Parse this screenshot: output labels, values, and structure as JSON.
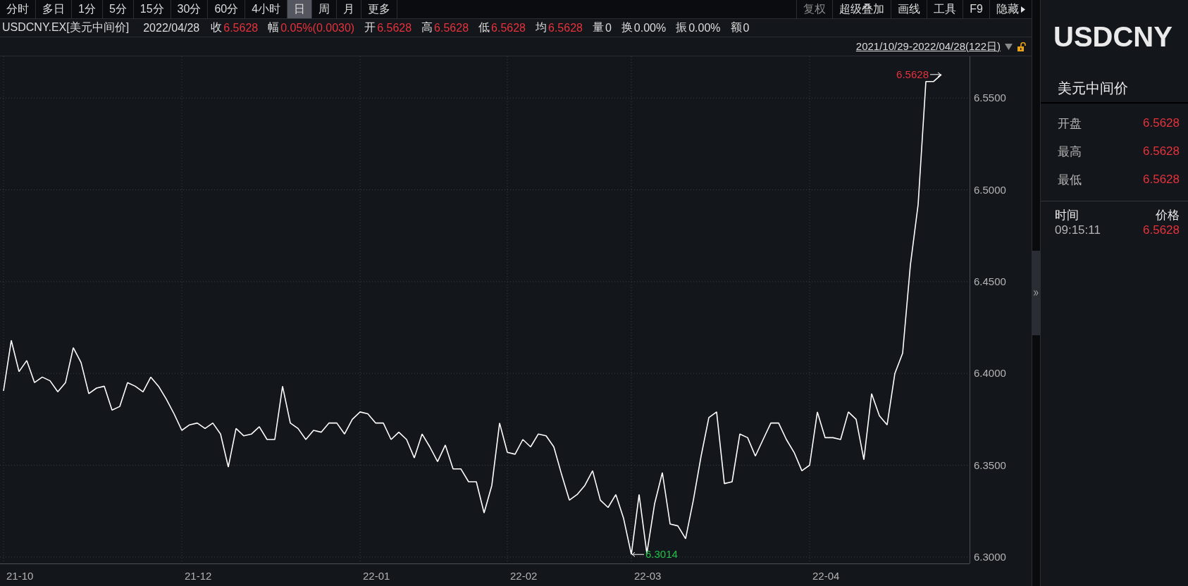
{
  "toolbar": {
    "periods": [
      {
        "label": "分时",
        "selected": false
      },
      {
        "label": "多日",
        "selected": false
      },
      {
        "label": "1分",
        "selected": false
      },
      {
        "label": "5分",
        "selected": false
      },
      {
        "label": "15分",
        "selected": false
      },
      {
        "label": "30分",
        "selected": false
      },
      {
        "label": "60分",
        "selected": false
      },
      {
        "label": "4小时",
        "selected": false
      },
      {
        "label": "日",
        "selected": true
      },
      {
        "label": "周",
        "selected": false
      },
      {
        "label": "月",
        "selected": false
      },
      {
        "label": "更多",
        "selected": false
      }
    ],
    "tools": [
      {
        "label": "复权",
        "disabled": true
      },
      {
        "label": "超级叠加",
        "disabled": false
      },
      {
        "label": "画线",
        "disabled": false
      },
      {
        "label": "工具",
        "disabled": false
      },
      {
        "label": "F9",
        "disabled": false
      },
      {
        "label": "隐藏",
        "disabled": false
      }
    ]
  },
  "quote": {
    "symbol": "USDCNY.EX[美元中间价]",
    "date": "2022/04/28",
    "fields": [
      {
        "label": "收",
        "value": "6.5628",
        "color": "#e8323c"
      },
      {
        "label": "幅",
        "value": "0.05%(0.0030)",
        "color": "#e8323c"
      },
      {
        "label": "开",
        "value": "6.5628",
        "color": "#e8323c"
      },
      {
        "label": "高",
        "value": "6.5628",
        "color": "#e8323c"
      },
      {
        "label": "低",
        "value": "6.5628",
        "color": "#e8323c"
      },
      {
        "label": "均",
        "value": "6.5628",
        "color": "#e8323c"
      },
      {
        "label": "量",
        "value": "0",
        "color": "#dcdcdc"
      },
      {
        "label": "换",
        "value": "0.00%",
        "color": "#dcdcdc"
      },
      {
        "label": "振",
        "value": "0.00%",
        "color": "#dcdcdc"
      },
      {
        "label": "额",
        "value": "0",
        "color": "#dcdcdc"
      }
    ]
  },
  "range": {
    "label": "2021/10/29-2022/04/28(122日)",
    "locked": false
  },
  "chart": {
    "chart_data": {
      "type": "line",
      "grid": true,
      "ylim": [
        6.2965,
        6.5727
      ],
      "yticks": [
        {
          "value": 6.3,
          "label": "6.3000"
        },
        {
          "value": 6.35,
          "label": "6.3500"
        },
        {
          "value": 6.4,
          "label": "6.4000"
        },
        {
          "value": 6.45,
          "label": "6.4500"
        },
        {
          "value": 6.5,
          "label": "6.5000"
        },
        {
          "value": 6.55,
          "label": "6.5500"
        }
      ],
      "series": [
        {
          "color": "#ffffff",
          "values": [
            6.3905,
            6.418,
            6.401,
            6.407,
            6.395,
            6.398,
            6.396,
            6.39,
            6.395,
            6.414,
            6.406,
            6.389,
            6.392,
            6.393,
            6.38,
            6.382,
            6.395,
            6.393,
            6.39,
            6.398,
            6.393,
            6.386,
            6.378,
            6.369,
            6.372,
            6.373,
            6.37,
            6.373,
            6.367,
            6.349,
            6.37,
            6.366,
            6.367,
            6.371,
            6.364,
            6.364,
            6.393,
            6.373,
            6.37,
            6.364,
            6.369,
            6.368,
            6.373,
            6.373,
            6.367,
            6.375,
            6.379,
            6.378,
            6.373,
            6.373,
            6.364,
            6.368,
            6.364,
            6.354,
            6.367,
            6.36,
            6.352,
            6.361,
            6.348,
            6.348,
            6.341,
            6.341,
            6.324,
            6.339,
            6.373,
            6.357,
            6.356,
            6.364,
            6.36,
            6.367,
            6.366,
            6.36,
            6.345,
            6.331,
            6.334,
            6.339,
            6.347,
            6.331,
            6.327,
            6.334,
            6.321,
            6.3014,
            6.334,
            6.302,
            6.329,
            6.346,
            6.318,
            6.317,
            6.31,
            6.331,
            6.355,
            6.376,
            6.379,
            6.34,
            6.341,
            6.367,
            6.365,
            6.355,
            6.364,
            6.373,
            6.373,
            6.364,
            6.357,
            6.347,
            6.35,
            6.379,
            6.365,
            6.365,
            6.364,
            6.379,
            6.375,
            6.353,
            6.389,
            6.377,
            6.372,
            6.4,
            6.411,
            6.459,
            6.492,
            6.559,
            6.559,
            6.5628
          ]
        }
      ],
      "annotations": [
        "6.5628",
        "6.3014"
      ]
    },
    "month_labels": [
      "21-10",
      "21-12",
      "22-01",
      "22-02",
      "22-03",
      "22-04"
    ]
  },
  "panel": {
    "title": "USDCNY",
    "subtitle": "美元中间价",
    "stats": [
      {
        "label": "开盘",
        "value": "6.5628"
      },
      {
        "label": "最高",
        "value": "6.5628"
      },
      {
        "label": "最低",
        "value": "6.5628"
      }
    ],
    "ticks": {
      "columns": [
        "时间",
        "价格"
      ],
      "rows": [
        {
          "time": "09:15:11",
          "price": "6.5628"
        }
      ]
    }
  }
}
